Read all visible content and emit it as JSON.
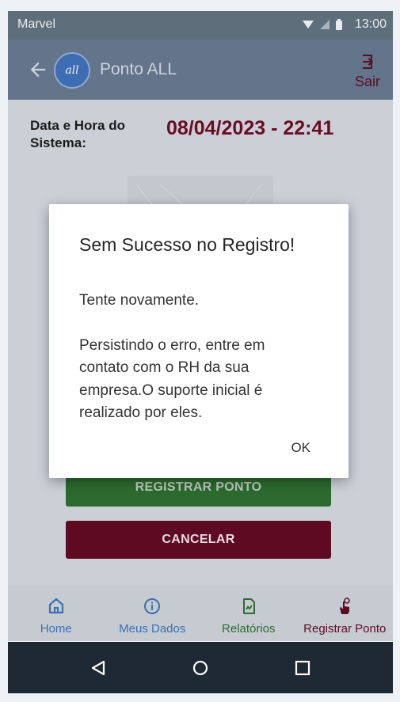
{
  "status_bar": {
    "carrier": "Marvel",
    "time": "13:00"
  },
  "app_bar": {
    "logo_text": "all",
    "title": "Ponto ALL",
    "logout_label": "Sair"
  },
  "main": {
    "datetime_label": "Data e Hora do Sistema:",
    "datetime_value": "08/04/2023 - 22:41",
    "register_button": "REGISTRAR PONTO",
    "cancel_button": "CANCELAR"
  },
  "dialog": {
    "title": "Sem Sucesso no Registro!",
    "message_1": "Tente novamente.",
    "message_2": "Persistindo o erro, entre em contato com o RH da sua empresa.O suporte inicial é realizado por eles.",
    "ok_label": "OK"
  },
  "bottom_nav": {
    "items": [
      {
        "label": "Home",
        "icon": "home-icon",
        "color": "#3b6fb0"
      },
      {
        "label": "Meus Dados",
        "icon": "info-icon",
        "color": "#3b6fb0"
      },
      {
        "label": "Relatórios",
        "icon": "report-icon",
        "color": "#2f6b2f"
      },
      {
        "label": "Registrar Ponto",
        "icon": "touch-icon",
        "color": "#5e0a22"
      }
    ]
  },
  "colors": {
    "accent_wine": "#6b0c24",
    "accent_blue": "#3b6fb0",
    "accent_green": "#2c6a2f"
  }
}
